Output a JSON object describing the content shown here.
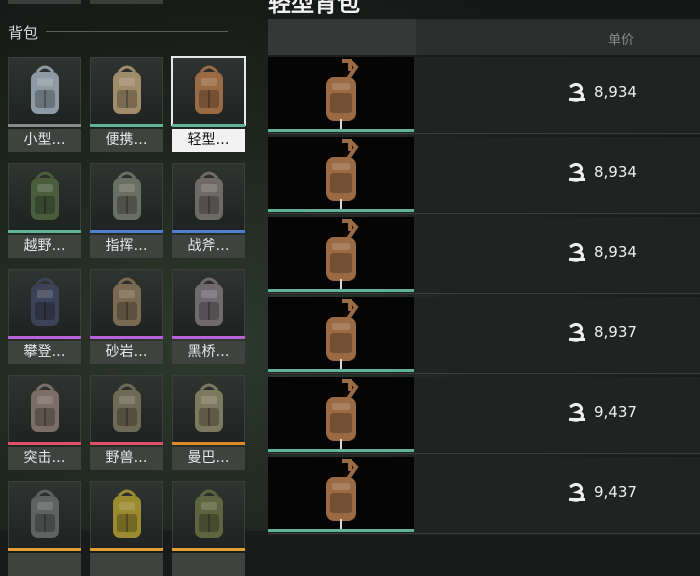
{
  "section": {
    "title": "背包"
  },
  "header": {
    "title": "轻型背包",
    "price_label": "单价"
  },
  "items": [
    {
      "label": "小型…",
      "rarity": "#8a8a8a",
      "color": "#8e9aa3",
      "selected": false
    },
    {
      "label": "便携…",
      "rarity": "#5fb39a",
      "color": "#a08c6a",
      "selected": false
    },
    {
      "label": "轻型…",
      "rarity": "#5fb39a",
      "color": "#9a6a45",
      "selected": true
    },
    {
      "label": "越野…",
      "rarity": "#5fb39a",
      "color": "#4a5e3e",
      "selected": false
    },
    {
      "label": "指挥…",
      "rarity": "#4e7fd0",
      "color": "#6b6e62",
      "selected": false
    },
    {
      "label": "战斧…",
      "rarity": "#4e7fd0",
      "color": "#6e6b66",
      "selected": false
    },
    {
      "label": "攀登…",
      "rarity": "#b563d6",
      "color": "#3d4356",
      "selected": false
    },
    {
      "label": "砂岩…",
      "rarity": "#b563d6",
      "color": "#7a6a52",
      "selected": false
    },
    {
      "label": "黑桥…",
      "rarity": "#b563d6",
      "color": "#6f6a6e",
      "selected": false
    },
    {
      "label": "突击…",
      "rarity": "#e0506a",
      "color": "#7a6e66",
      "selected": false
    },
    {
      "label": "野兽…",
      "rarity": "#e0506a",
      "color": "#6e6a55",
      "selected": false
    },
    {
      "label": "曼巴…",
      "rarity": "#e08a2e",
      "color": "#7c7a5e",
      "selected": false
    },
    {
      "label": "",
      "rarity": "#e0a030",
      "color": "#5f6260",
      "selected": false
    },
    {
      "label": "",
      "rarity": "#e0a030",
      "color": "#9a8a30",
      "selected": false
    },
    {
      "label": "",
      "rarity": "#e0a030",
      "color": "#5e6440",
      "selected": false
    }
  ],
  "listings": [
    {
      "price": "8,934"
    },
    {
      "price": "8,934"
    },
    {
      "price": "8,934"
    },
    {
      "price": "8,937"
    },
    {
      "price": "9,437"
    },
    {
      "price": "9,437"
    }
  ],
  "colors": {
    "accent_bar": "#5fb39a",
    "coin_icon": "coin-icon"
  }
}
